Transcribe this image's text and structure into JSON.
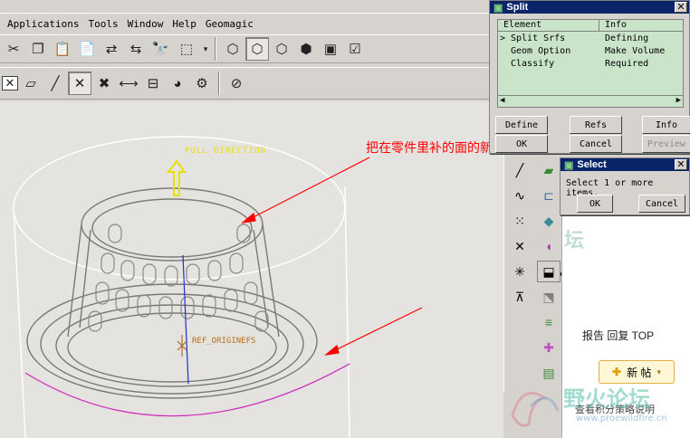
{
  "menu": [
    "Applications",
    "Tools",
    "Window",
    "Help",
    "Geomagic"
  ],
  "viewport": {
    "pull_direction_label": "PULL DIRECTION",
    "origin_label": "REF_ORIGINEFS",
    "annotation": "把在零件里补的面的新做的一起选上",
    "annotation_color": "#ff0000"
  },
  "split_dialog": {
    "title": "Split",
    "columns": [
      "Element",
      "Info"
    ],
    "rows": [
      {
        "element": "Split Srfs",
        "info": "Defining",
        "current": true
      },
      {
        "element": "Geom Option",
        "info": "Make Volume"
      },
      {
        "element": "Classify",
        "info": "Required"
      }
    ],
    "buttons": {
      "define": "Define",
      "refs": "Refs",
      "info": "Info",
      "ok": "OK",
      "cancel": "Cancel",
      "preview": "Preview"
    }
  },
  "select_dialog": {
    "title": "Select",
    "message": "Select 1 or more items.",
    "ok": "OK",
    "cancel": "Cancel"
  },
  "web": {
    "nav": "报告  回复  TOP",
    "new_post": "新 帖",
    "policy": "查看积分策略说明",
    "watermark": "野火论坛",
    "watermark_url": "www.proewildfire.cn"
  },
  "colors": {
    "titlebar": "#0a246a",
    "table_bg": "#c9e4c9",
    "model_lines": "#7a7a72",
    "pink_edge": "#d030c0"
  }
}
